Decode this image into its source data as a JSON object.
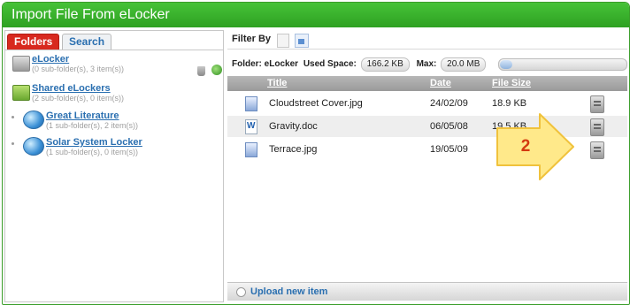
{
  "window": {
    "title": "Import File From eLocker"
  },
  "left_pane": {
    "tabs": {
      "folders": "Folders",
      "search": "Search"
    },
    "folders": [
      {
        "name": "eLocker",
        "detail": "(0 sub-folder(s), 3 item(s))",
        "icon": "locker-gray-icon"
      },
      {
        "name": "Shared eLockers",
        "detail": "(2 sub-folder(s), 0 item(s))",
        "icon": "locker-green-icon"
      },
      {
        "name": "Great Literature",
        "detail": "(1 sub-folder(s), 2 item(s))",
        "icon": "globe-folder-icon"
      },
      {
        "name": "Solar System Locker",
        "detail": "(1 sub-folder(s), 0 item(s))",
        "icon": "globe-folder-icon"
      }
    ]
  },
  "right_pane": {
    "filter_label": "Filter By",
    "info": {
      "folder_label": "Folder:",
      "folder_value": "eLocker",
      "used_label": "Used Space:",
      "used_value": "166.2 KB",
      "max_label": "Max:",
      "max_value": "20.0 MB",
      "usage_fraction": 0.008
    },
    "table": {
      "headers": {
        "title": "Title",
        "date": "Date",
        "size": "File Size"
      },
      "rows": [
        {
          "title": "Cloudstreet Cover.jpg",
          "date": "24/02/09",
          "size": "18.9 KB",
          "type": "jpg"
        },
        {
          "title": "Gravity.doc",
          "date": "06/05/08",
          "size": "19.5 KB",
          "type": "doc"
        },
        {
          "title": "Terrace.jpg",
          "date": "19/05/09",
          "size": "",
          "type": "jpg"
        }
      ]
    },
    "footer": {
      "upload_label": "Upload new item"
    }
  },
  "annotation": {
    "number": "2",
    "colors": {
      "fill": "#ffe98a",
      "stroke": "#f0c23c",
      "text": "#d43a10"
    }
  }
}
